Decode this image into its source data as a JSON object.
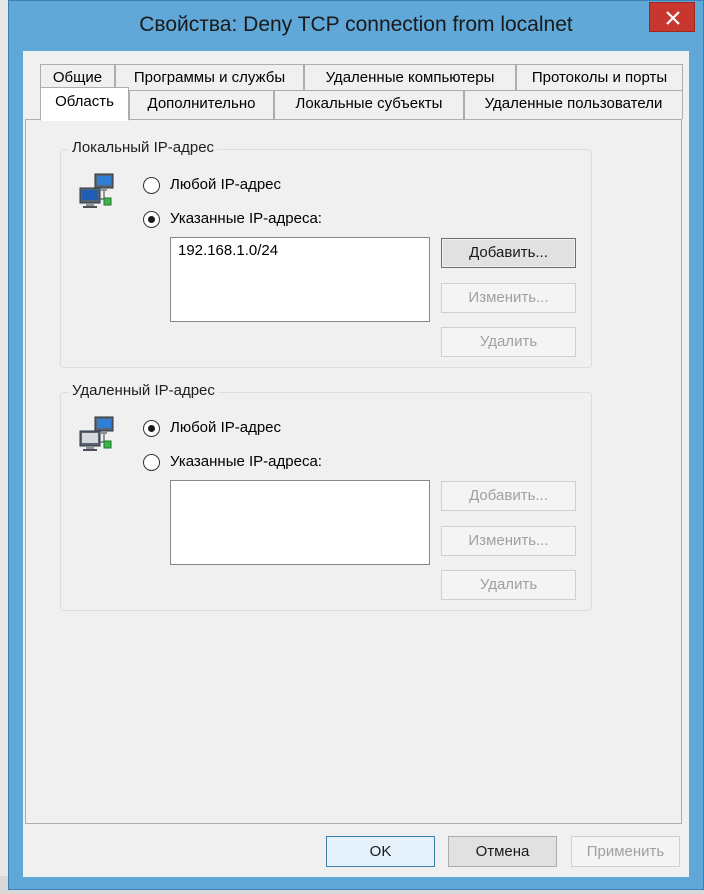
{
  "window": {
    "title": "Свойства: Deny TCP connection from localnet"
  },
  "tabs": {
    "row1": [
      "Общие",
      "Программы и службы",
      "Удаленные компьютеры",
      "Протоколы и порты"
    ],
    "row2": [
      "Область",
      "Дополнительно",
      "Локальные субъекты",
      "Удаленные пользователи"
    ],
    "active": "Область"
  },
  "local_ip": {
    "legend": "Локальный IP-адрес",
    "radio_any": "Любой IP-адрес",
    "radio_specified": "Указанные IP-адреса:",
    "selected": "specified",
    "addresses": [
      "192.168.1.0/24"
    ],
    "add_label": "Добавить...",
    "edit_label": "Изменить...",
    "remove_label": "Удалить"
  },
  "remote_ip": {
    "legend": "Удаленный IP-адрес",
    "radio_any": "Любой IP-адрес",
    "radio_specified": "Указанные IP-адреса:",
    "selected": "any",
    "addresses": [],
    "add_label": "Добавить...",
    "edit_label": "Изменить...",
    "remove_label": "Удалить"
  },
  "footer": {
    "ok_label": "OK",
    "cancel_label": "Отмена",
    "apply_label": "Применить"
  },
  "icons": {
    "close": "close-icon",
    "network": "network-computers-icon"
  },
  "colors": {
    "title_bar": "#5fa8d8",
    "close_button": "#c7372f"
  }
}
